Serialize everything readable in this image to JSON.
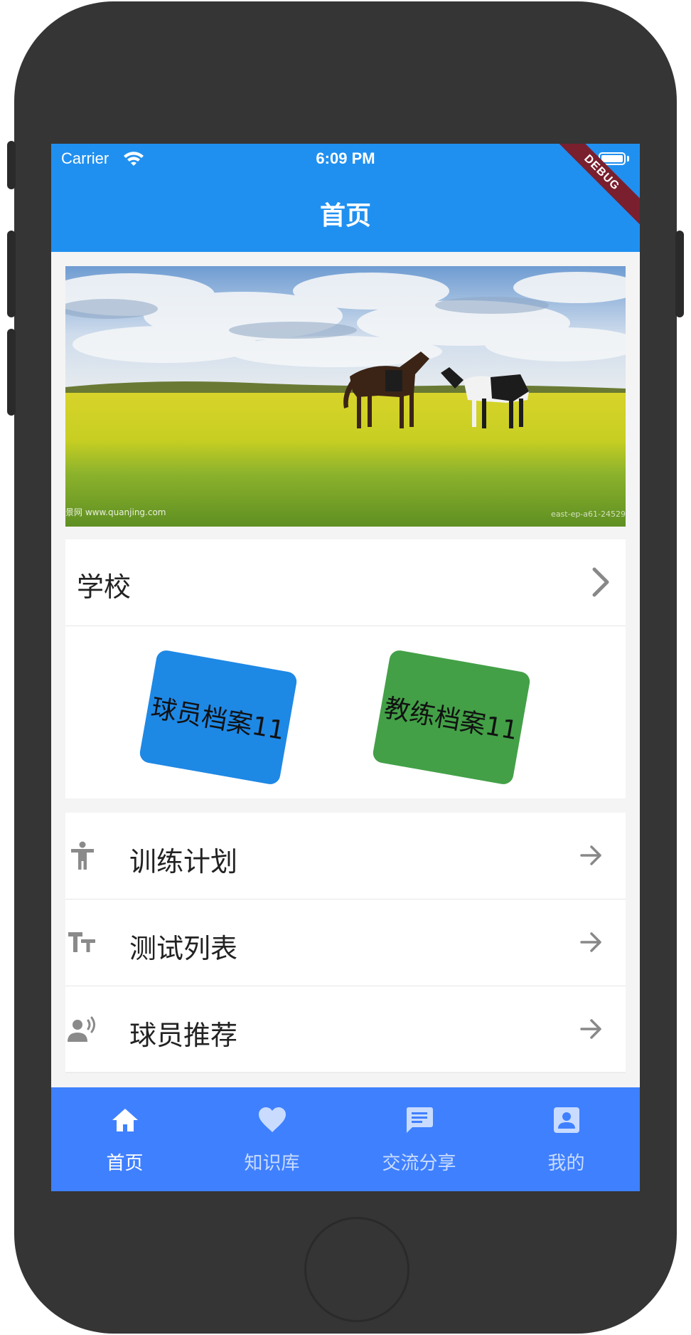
{
  "status_bar": {
    "carrier": "Carrier",
    "time": "6:09 PM"
  },
  "app_bar": {
    "title": "首页",
    "debug_badge": "DEBUG"
  },
  "banner": {
    "watermark_left": "景网 www.quanjing.com",
    "watermark_right": "east-ep-a61-24529"
  },
  "school_row": {
    "label": "学校"
  },
  "cards": [
    {
      "label": "球员档案11",
      "color": "#1e88e5"
    },
    {
      "label": "教练档案11",
      "color": "#43a047"
    }
  ],
  "menu": [
    {
      "label": "训练计划",
      "icon": "accessibility-icon"
    },
    {
      "label": "测试列表",
      "icon": "text-fields-icon"
    },
    {
      "label": "球员推荐",
      "icon": "record-voice-icon"
    }
  ],
  "bottom_nav": {
    "items": [
      {
        "label": "首页",
        "icon": "home-icon",
        "active": true
      },
      {
        "label": "知识库",
        "icon": "heart-icon",
        "active": false
      },
      {
        "label": "交流分享",
        "icon": "chat-icon",
        "active": false
      },
      {
        "label": "我的",
        "icon": "account-box-icon",
        "active": false
      }
    ]
  },
  "colors": {
    "app_bar": "#2090f0",
    "bottom_nav": "#3f80ff",
    "background": "#f4f4f4",
    "device": "#353535"
  }
}
